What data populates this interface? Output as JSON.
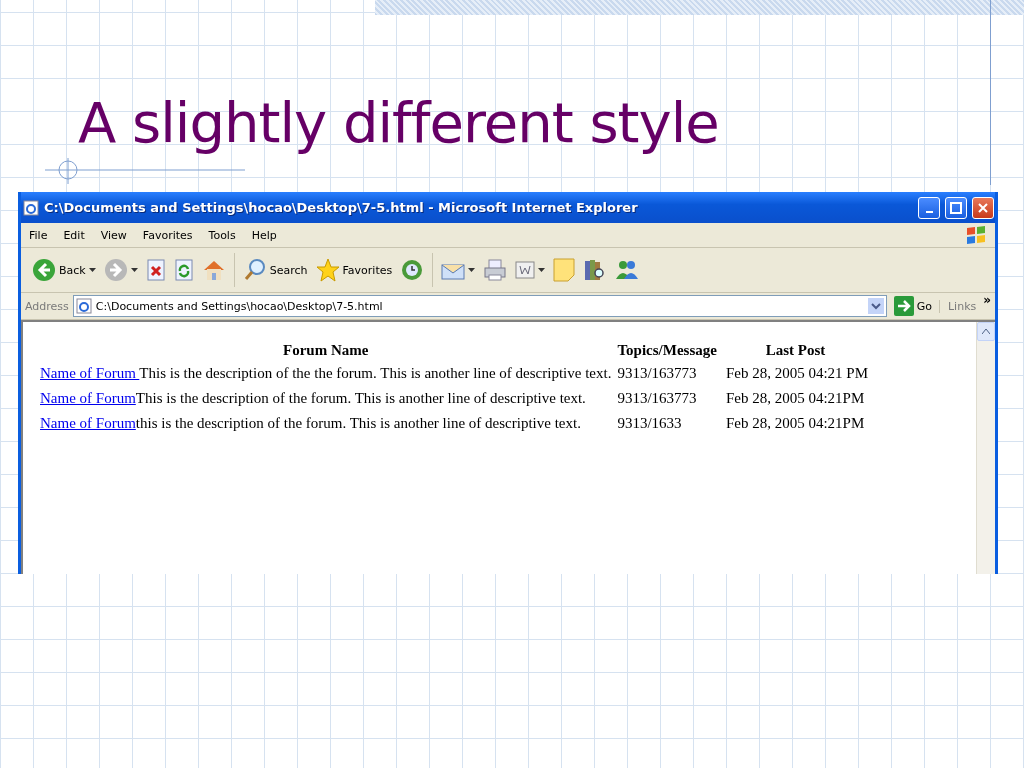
{
  "slide": {
    "title": "A slightly different style"
  },
  "window": {
    "title": "C:\\Documents and Settings\\hocao\\Desktop\\7-5.html - Microsoft Internet Explorer"
  },
  "menu": [
    "File",
    "Edit",
    "View",
    "Favorites",
    "Tools",
    "Help"
  ],
  "toolbar": [
    {
      "kind": "back",
      "label": "Back",
      "dropdown": true
    },
    {
      "kind": "forward",
      "dropdown": true
    },
    {
      "kind": "stop",
      "dropdown": false
    },
    {
      "kind": "refresh",
      "dropdown": false
    },
    {
      "kind": "home",
      "dropdown": false
    },
    {
      "kind": "search",
      "label": "Search",
      "dropdown": false
    },
    {
      "kind": "favorites",
      "label": "Favorites",
      "dropdown": false
    },
    {
      "kind": "history",
      "dropdown": false
    },
    {
      "kind": "mail",
      "dropdown": true
    },
    {
      "kind": "print",
      "dropdown": false
    },
    {
      "kind": "edit",
      "dropdown": true
    },
    {
      "kind": "note",
      "dropdown": false
    },
    {
      "kind": "research",
      "dropdown": false
    },
    {
      "kind": "messenger",
      "dropdown": false
    }
  ],
  "address": {
    "label": "Address",
    "value": "C:\\Documents and Settings\\hocao\\Desktop\\7-5.html",
    "go": "Go",
    "links": "Links",
    "more": "»"
  },
  "table": {
    "columns": [
      "Forum Name",
      "Topics/Message",
      "Last Post"
    ],
    "rows": [
      {
        "name": "Name of Forum ",
        "description": "This is the description of the the forum. This is another line of descriptive text.",
        "topics": "9313/163773",
        "last_post": "Feb 28, 2005 04:21 PM"
      },
      {
        "name": "Name of Forum",
        "description": "This is the description of the forum. This is another line of descriptive text.",
        "topics": "9313/163773",
        "last_post": "Feb 28, 2005 04:21PM"
      },
      {
        "name": "Name of Forum",
        "description": "this is the description of the forum. This is another line of descriptive text.",
        "topics": "9313/1633",
        "last_post": "Feb 28, 2005 04:21PM"
      }
    ]
  }
}
